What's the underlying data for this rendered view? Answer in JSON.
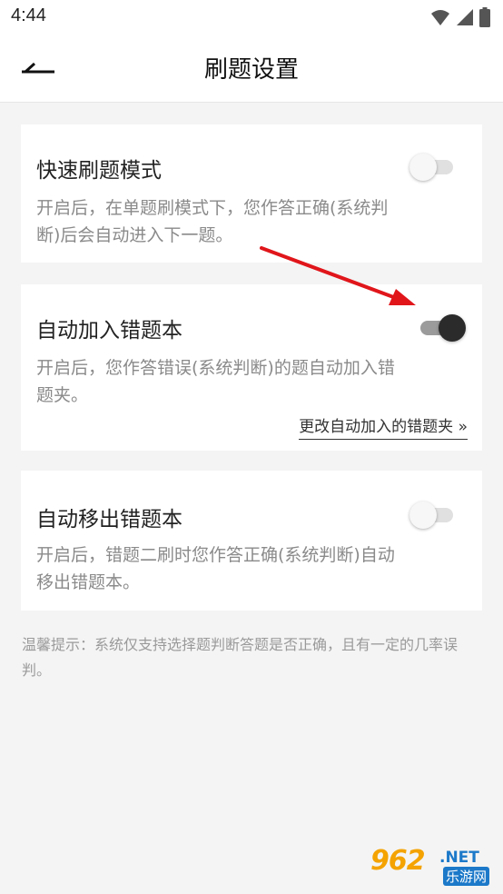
{
  "status_bar": {
    "time": "4:44"
  },
  "header": {
    "title": "刷题设置"
  },
  "settings": [
    {
      "title": "快速刷题模式",
      "description": "开启后，在单题刷模式下，您作答正确(系统判断)后会自动进入下一题。",
      "enabled": false
    },
    {
      "title": "自动加入错题本",
      "description": "开启后，您作答错误(系统判断)的题自动加入错题夹。",
      "enabled": true,
      "link": "更改自动加入的错题夹 »"
    },
    {
      "title": "自动移出错题本",
      "description": "开启后，错题二刷时您作答正确(系统判断)自动移出错题本。",
      "enabled": false
    }
  ],
  "tip": "温馨提示：系统仅支持选择题判断答题是否正确，且有一定的几率误判。",
  "watermark": {
    "number": "962",
    "suffix": ".NET",
    "label": "乐游网"
  },
  "colors": {
    "annotation_arrow": "#e0161b",
    "toggle_on": "#2b2b2b",
    "toggle_off": "#f7f7f7"
  },
  "icons": [
    "wifi-icon",
    "signal-icon",
    "battery-icon",
    "back-arrow-icon"
  ]
}
